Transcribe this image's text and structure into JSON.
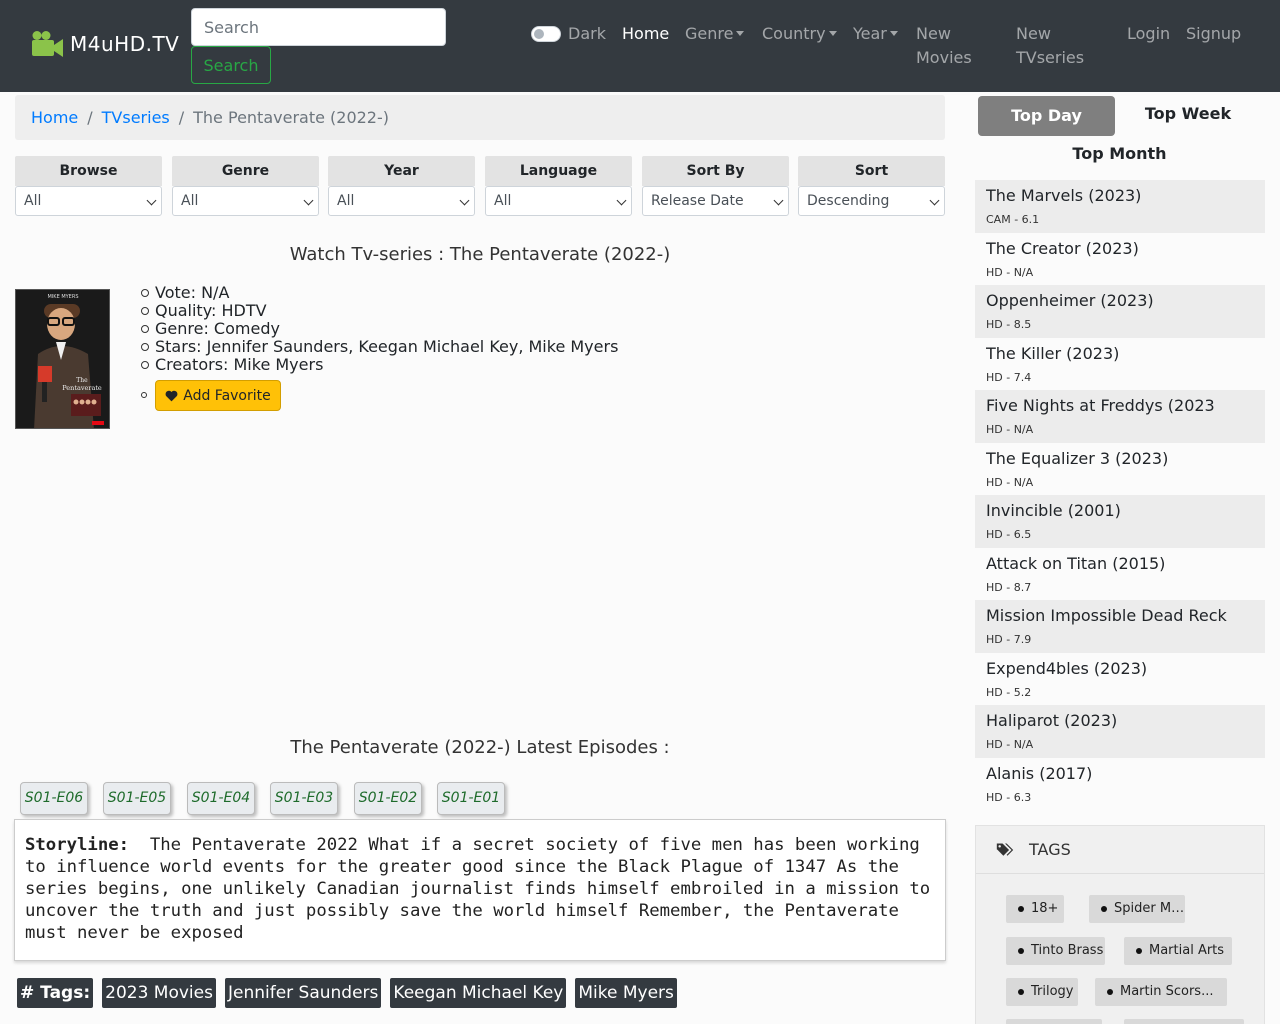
{
  "navbar": {
    "brand": "M4uHD.TV",
    "search_placeholder": "Search",
    "search_button": "Search",
    "dark_label": "Dark",
    "home": "Home",
    "genre": "Genre",
    "country": "Country",
    "year": "Year",
    "new_movies_1": "New",
    "new_movies_2": "Movies",
    "new_tvseries_1": "New",
    "new_tvseries_2": "TVseries",
    "login": "Login",
    "signup": "Signup"
  },
  "breadcrumb": {
    "home": "Home",
    "sep": "/",
    "tvseries": "TVseries",
    "current": "The Pentaverate (2022-)"
  },
  "filters": [
    {
      "label": "Browse",
      "value": "All"
    },
    {
      "label": "Genre",
      "value": "All"
    },
    {
      "label": "Year",
      "value": "All"
    },
    {
      "label": "Language",
      "value": "All"
    },
    {
      "label": "Sort By",
      "value": "Release Date"
    },
    {
      "label": "Sort",
      "value": "Descending"
    }
  ],
  "watch_title": "Watch Tv-series : The Pentaverate (2022-)",
  "info": {
    "vote": "Vote: N/A",
    "quality": "Quality: HDTV",
    "genre": "Genre: Comedy",
    "stars": "Stars: Jennifer Saunders, Keegan Michael Key, Mike Myers",
    "creators": "Creators: Mike Myers",
    "add_favorite": "Add Favorite"
  },
  "poster": {
    "top_text": "MIKE MYERS",
    "title_1": "The",
    "title_2": "Pentaverate"
  },
  "episodes_title": "The Pentaverate (2022-) Latest Episodes :",
  "episodes": [
    "S01-E06",
    "S01-E05",
    "S01-E04",
    "S01-E03",
    "S01-E02",
    "S01-E01"
  ],
  "storyline": {
    "label": "Storyline:",
    "text": "The Pentaverate 2022 What if a secret society of five men has been working to influence world events for the greater good since the Black Plague of 1347 As the series begins, one unlikely Canadian journalist finds himself embroiled in a mission to uncover the truth and just possibly save the world himself Remember, the Pentaverate must never be exposed"
  },
  "tags_row": {
    "label": "# Tags:",
    "items": [
      "2023 Movies",
      "Jennifer Saunders",
      "Keegan Michael Key",
      "Mike Myers"
    ]
  },
  "sidebar": {
    "top_day": "Top Day",
    "top_week": "Top Week",
    "top_month": "Top Month",
    "movies": [
      {
        "title": "The Marvels (2023)",
        "sub": "CAM - 6.1"
      },
      {
        "title": "The Creator (2023)",
        "sub": "HD - N/A"
      },
      {
        "title": "Oppenheimer (2023)",
        "sub": "HD - 8.5"
      },
      {
        "title": "The Killer (2023)",
        "sub": "HD - 7.4"
      },
      {
        "title": "Five Nights at Freddys (2023",
        "sub": "HD - N/A"
      },
      {
        "title": "The Equalizer 3 (2023)",
        "sub": "HD - N/A"
      },
      {
        "title": "Invincible (2001)",
        "sub": "HD - 6.5"
      },
      {
        "title": "Attack on Titan (2015)",
        "sub": "HD - 8.7"
      },
      {
        "title": "Mission Impossible Dead Reck",
        "sub": "HD - 7.9"
      },
      {
        "title": "Expend4bles (2023)",
        "sub": "HD - 5.2"
      },
      {
        "title": "Haliparot (2023)",
        "sub": "HD - N/A"
      },
      {
        "title": "Alanis (2017)",
        "sub": "HD - 6.3"
      }
    ],
    "tags_heading": "TAGS",
    "tags": [
      "18+",
      "Spider Man",
      "Tinto Brass",
      "Martial Arts",
      "Trilogy",
      "Martin Scors..."
    ]
  },
  "colors": {
    "navbar": "#343a40",
    "link": "#007bff",
    "success": "#28a745",
    "warning": "#ffc107"
  }
}
